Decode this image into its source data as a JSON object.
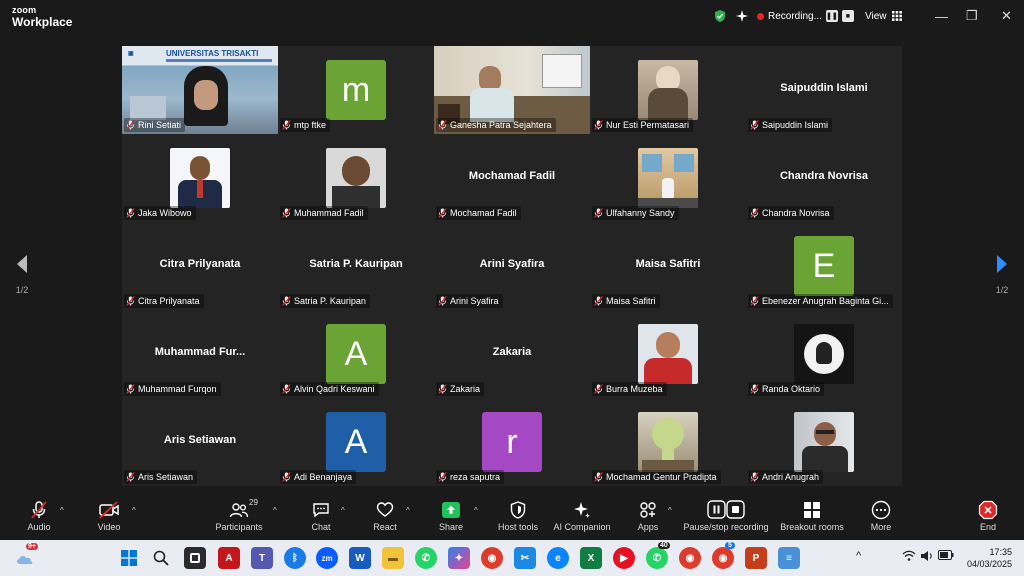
{
  "app": {
    "brand_top": "zoom",
    "brand_bottom": "Workplace"
  },
  "titlebar": {
    "recording": "Recording...",
    "view": "View"
  },
  "pager": {
    "count": "1/2"
  },
  "participants": [
    {
      "name": "Rini Setiati",
      "kind": "video",
      "video": "banner",
      "banner_title": "UNIVERSITAS TRISAKTI",
      "active": true
    },
    {
      "name": "mtp ftke",
      "kind": "avatar",
      "initial": "m",
      "color": "#6aa435"
    },
    {
      "name": "Ganesha Patra Sejahtera",
      "kind": "video",
      "video": "office"
    },
    {
      "name": "Nur Esti Permatasari",
      "kind": "photo",
      "photo": "hijab"
    },
    {
      "name": "Saipuddin Islami",
      "kind": "name"
    },
    {
      "name": "Jaka Wibowo",
      "kind": "photo",
      "photo": "formal"
    },
    {
      "name": "Muhammad Fadil",
      "kind": "photo",
      "photo": "man"
    },
    {
      "name": "Mochamad Fadil",
      "kind": "name"
    },
    {
      "name": "Ulfahanny Sandy",
      "kind": "photo",
      "photo": "room"
    },
    {
      "name": "Chandra Novrisa",
      "kind": "name"
    },
    {
      "name": "Citra Prilyanata",
      "kind": "name"
    },
    {
      "name": "Satria P. Kauripan",
      "kind": "name"
    },
    {
      "name": "Arini Syafira",
      "kind": "name"
    },
    {
      "name": "Maisa Safitri",
      "kind": "name"
    },
    {
      "name": "Ebenezer Anugrah Baginta Gi...",
      "kind": "avatar",
      "initial": "E",
      "color": "#6aa435"
    },
    {
      "name": "Muhammad Furqon",
      "display": "Muhammad Fur...",
      "kind": "name"
    },
    {
      "name": "Alvin Qadri Keswani",
      "kind": "avatar",
      "initial": "A",
      "color": "#6aa435"
    },
    {
      "name": "Zakaria",
      "kind": "name"
    },
    {
      "name": "Burra Muzeba",
      "kind": "photo",
      "photo": "redshirt"
    },
    {
      "name": "Randa Oktario",
      "kind": "photo",
      "photo": "logo"
    },
    {
      "name": "Aris Setiawan",
      "kind": "name"
    },
    {
      "name": "Adi Benanjaya",
      "kind": "avatar",
      "initial": "A",
      "color": "#1f5fa8"
    },
    {
      "name": "reza saputra",
      "kind": "avatar",
      "initial": "r",
      "color": "#a548c4"
    },
    {
      "name": "Mochamad Gentur Pradipta",
      "kind": "photo",
      "photo": "melon"
    },
    {
      "name": "Andri Anugrah",
      "kind": "photo",
      "photo": "glasses"
    }
  ],
  "toolbar": {
    "audio": "Audio",
    "video": "Video",
    "participants": "Participants",
    "participants_count": "29",
    "chat": "Chat",
    "react": "React",
    "share": "Share",
    "host_tools": "Host tools",
    "ai_companion": "AI Companion",
    "apps": "Apps",
    "pause_stop": "Pause/stop recording",
    "breakout": "Breakout rooms",
    "more": "More",
    "end": "End"
  },
  "taskbar": {
    "weather_badge": "9+",
    "whatsapp_badge": "40",
    "chrome_badge": "5",
    "time": "17:35",
    "date": "04/03/2025"
  },
  "colors": {
    "accent_green": "#3ec44f",
    "end_red": "#e02828",
    "share_green": "#22c25a"
  }
}
